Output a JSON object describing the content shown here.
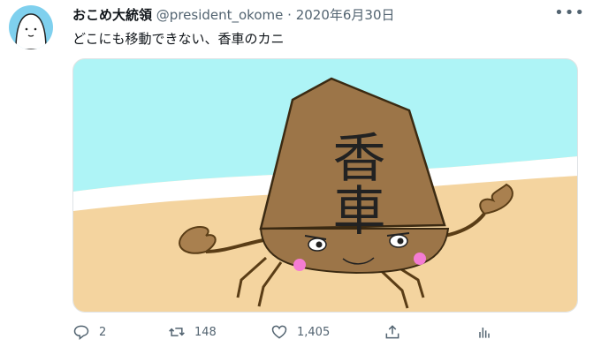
{
  "tweet": {
    "author_name": "おこめ大統領",
    "handle": "@president_okome",
    "separator": "·",
    "date": "2020年6月30日",
    "text": "どこにも移動できない、香車のカニ",
    "image_text": "香車"
  },
  "actions": {
    "reply_count": "2",
    "retweet_count": "148",
    "like_count": "1,405"
  },
  "icons": [
    "more-icon",
    "reply-icon",
    "retweet-icon",
    "like-icon",
    "share-icon",
    "analytics-icon"
  ],
  "colors": {
    "secondary_text": "#536471",
    "sky": "#aef2f5",
    "sand": "#f3d29c"
  }
}
